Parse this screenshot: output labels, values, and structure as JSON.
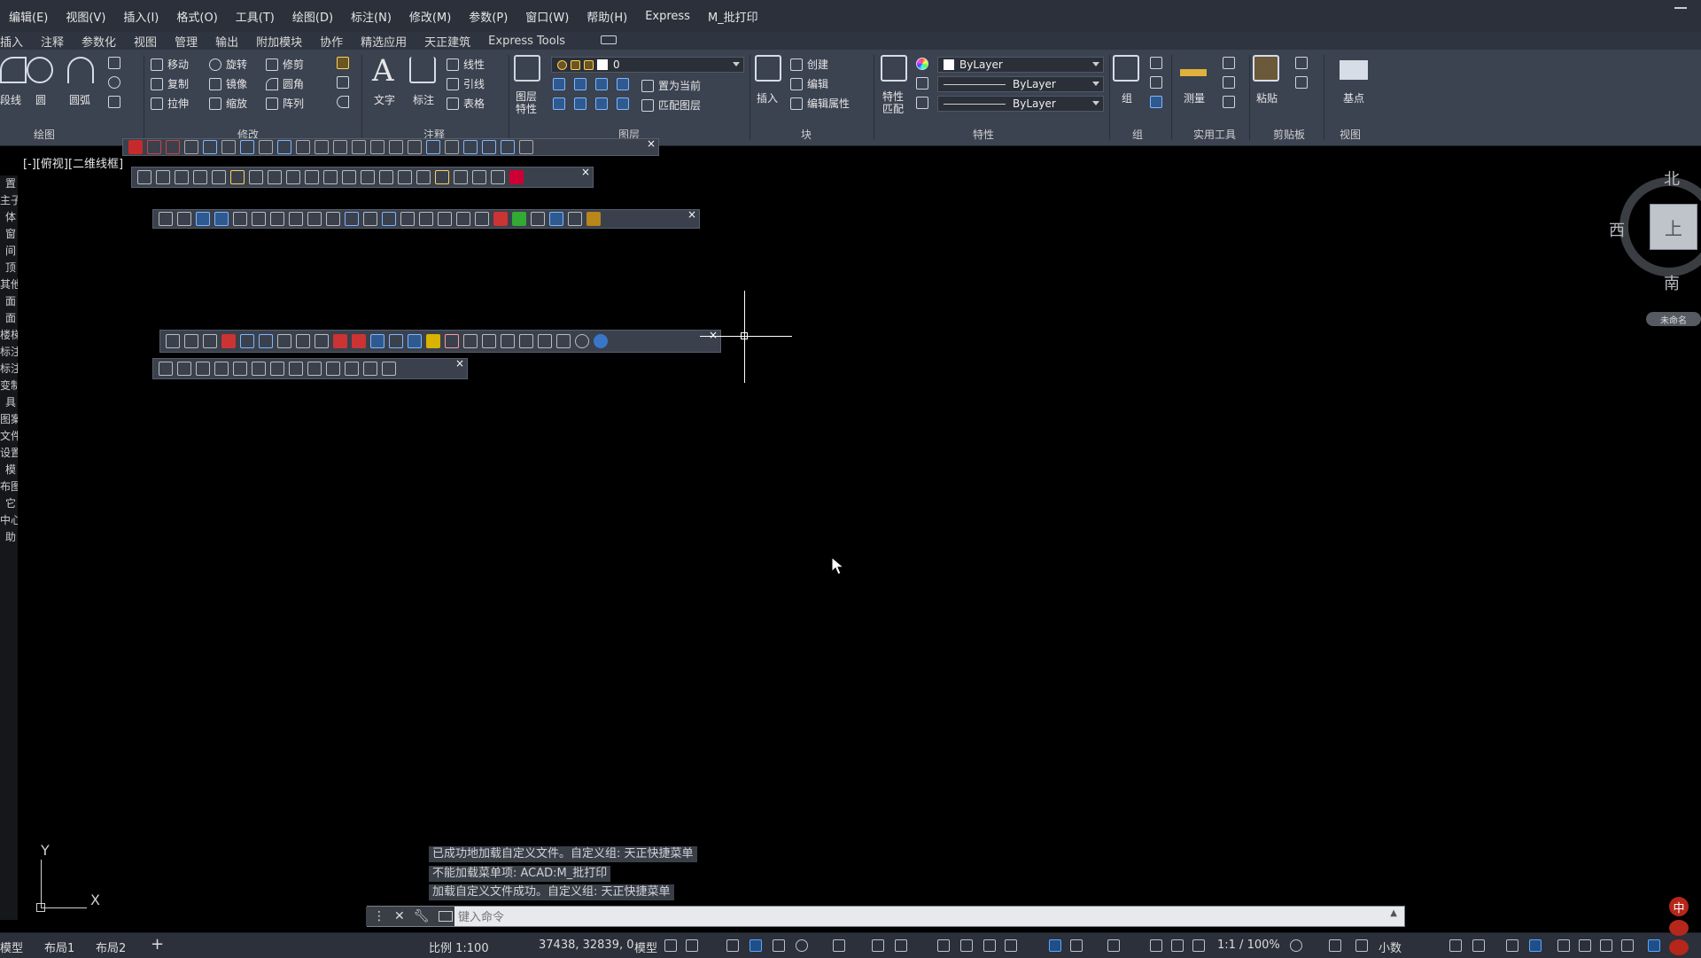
{
  "menu": [
    "编辑(E)",
    "视图(V)",
    "插入(I)",
    "格式(O)",
    "工具(T)",
    "绘图(D)",
    "标注(N)",
    "修改(M)",
    "参数(P)",
    "窗口(W)",
    "帮助(H)",
    "Express",
    "M_批打印"
  ],
  "tabs": [
    "插入",
    "注释",
    "参数化",
    "视图",
    "管理",
    "输出",
    "附加模块",
    "协作",
    "精选应用",
    "天正建筑",
    "Express Tools"
  ],
  "ribbon": {
    "draw": {
      "title": "绘图",
      "polyline": "段线",
      "circle": "圆",
      "arc": "圆弧"
    },
    "modify": {
      "title": "修改",
      "move": "移动",
      "rotate": "旋转",
      "trim": "修剪",
      "copy": "复制",
      "mirror": "镜像",
      "fillet": "圆角",
      "stretch": "拉伸",
      "scale": "缩放",
      "array": "阵列"
    },
    "annotation": {
      "title": "注释",
      "text": "文字",
      "dimension": "标注",
      "linear": "线性",
      "leader": "引线",
      "table": "表格"
    },
    "layers": {
      "title": "图层",
      "layer_props": "图层\n特性",
      "current_layer": "0",
      "set_current": "置为当前",
      "match_layer": "匹配图层"
    },
    "block": {
      "title": "块",
      "insert": "插入",
      "create": "创建",
      "edit": "编辑",
      "edit_attr": "编辑属性"
    },
    "properties": {
      "title": "特性",
      "match": "特性\n匹配",
      "color": "ByLayer",
      "linetype": "ByLayer",
      "lineweight": "ByLayer"
    },
    "group": {
      "title": "组",
      "group": "组"
    },
    "utilities": {
      "title": "实用工具",
      "measure": "测量"
    },
    "clipboard": {
      "title": "剪贴板",
      "paste": "粘贴"
    },
    "view": {
      "title": "视图",
      "base": "基点"
    }
  },
  "viewport_label": "[-][俯视][二维线框]",
  "left_palette": [
    "置",
    "主子",
    "体",
    "窗",
    "间",
    "顶",
    "其他",
    "面",
    "面",
    "楼梯",
    "标注",
    "标注",
    "变制",
    "具",
    "图案",
    "文件",
    "设置",
    "模",
    "布图",
    "它",
    "中心",
    "助"
  ],
  "viewcube": {
    "north": "北",
    "south": "南",
    "west": "西",
    "top": "上",
    "wcs": "未命名"
  },
  "ucs": {
    "x": "X",
    "y": "Y"
  },
  "history": [
    "已成功地加载自定义文件。自定义组: 天正快捷菜单",
    "不能加载菜单项: ACAD:M_批打印",
    "加载自定义文件成功。自定义组: 天正快捷菜单"
  ],
  "command": {
    "placeholder": "键入命令"
  },
  "status": {
    "model_tab": "模型",
    "layout1": "布局1",
    "layout2": "布局2",
    "add": "+",
    "scale": "比例 1:100",
    "coords": "37438, 32839, 0",
    "model": "模型",
    "annotation_scale": "1:1 / 100%",
    "units": "小数"
  },
  "tray": {
    "ime": "中"
  }
}
